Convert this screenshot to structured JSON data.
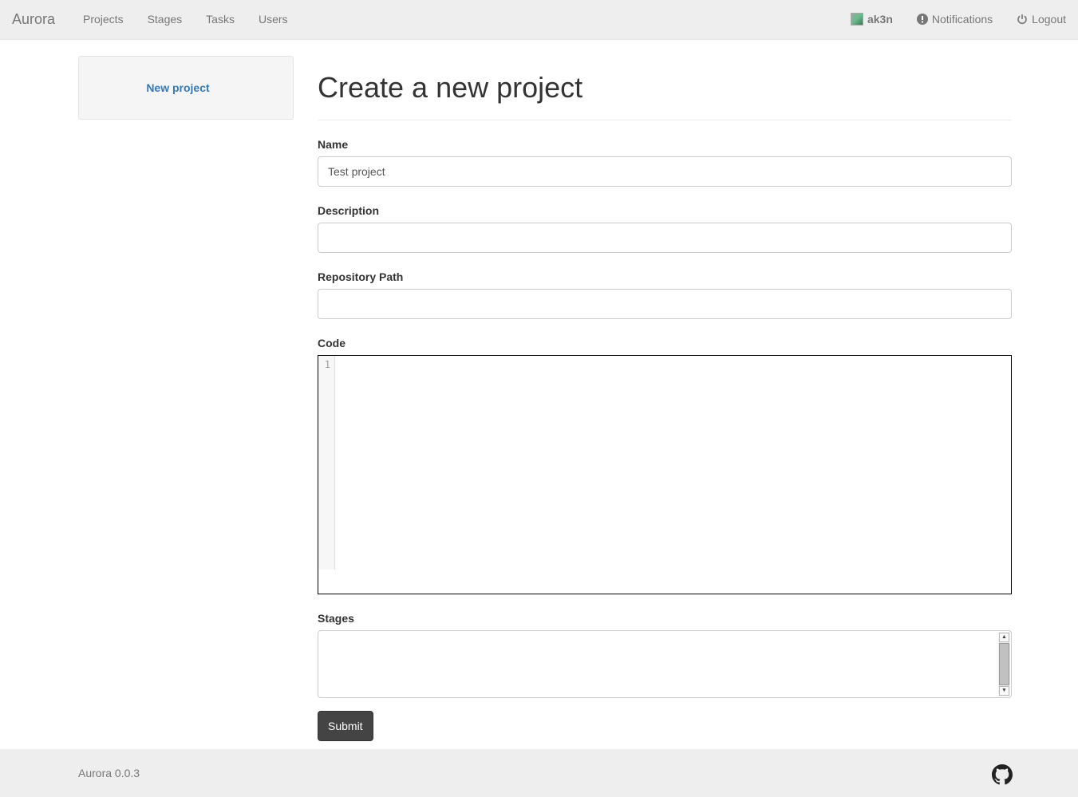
{
  "navbar": {
    "brand": "Aurora",
    "links": [
      {
        "label": "Projects"
      },
      {
        "label": "Stages"
      },
      {
        "label": "Tasks"
      },
      {
        "label": "Users"
      }
    ],
    "user": {
      "name": "ak3n"
    },
    "notifications_label": "Notifications",
    "logout_label": "Logout"
  },
  "sidebar": {
    "items": [
      {
        "label": "New project"
      }
    ]
  },
  "main": {
    "title": "Create a new project",
    "form": {
      "name": {
        "label": "Name",
        "value": "Test project"
      },
      "description": {
        "label": "Description",
        "value": ""
      },
      "repository_path": {
        "label": "Repository Path",
        "value": ""
      },
      "code": {
        "label": "Code",
        "line_number": "1"
      },
      "stages": {
        "label": "Stages"
      },
      "submit_label": "Submit"
    }
  },
  "footer": {
    "version": "Aurora 0.0.3",
    "github_icon": "github-icon"
  }
}
